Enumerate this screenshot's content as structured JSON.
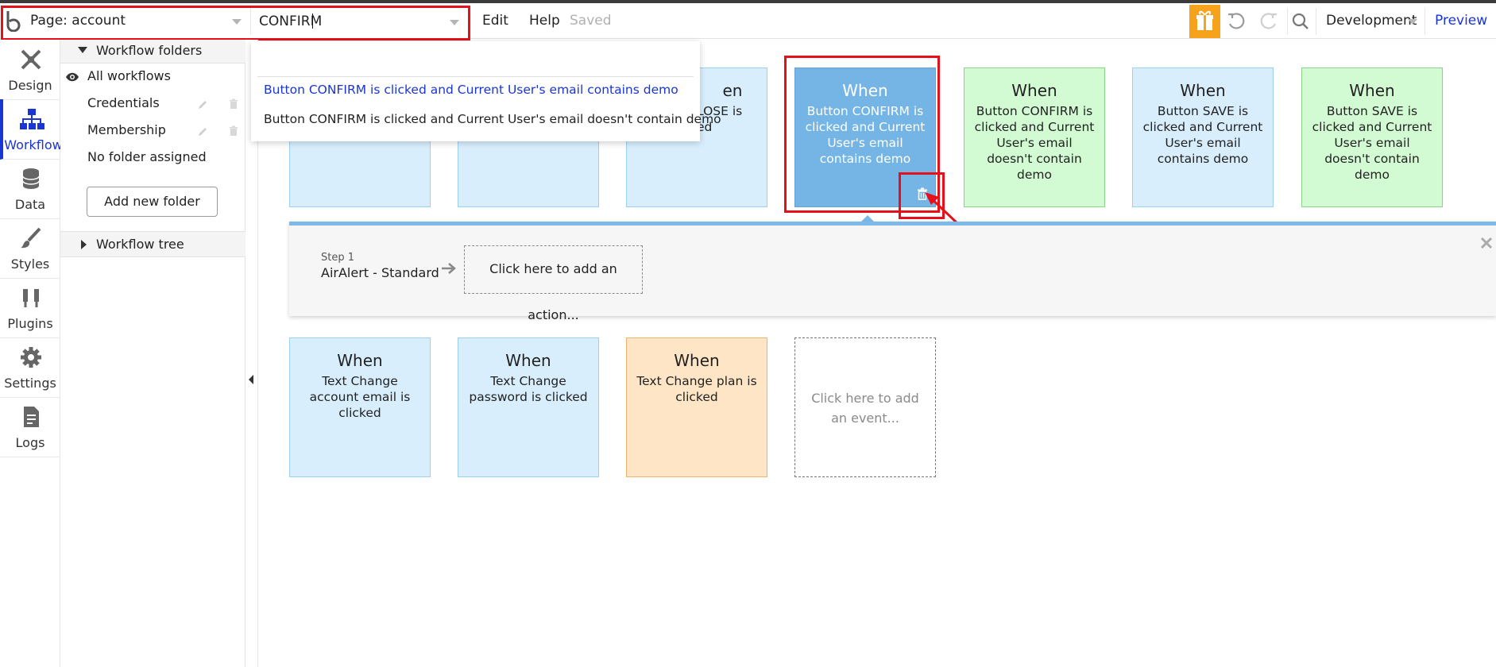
{
  "topbar": {
    "logo_icon": "bubble-logo-icon",
    "page_label": "Page: account",
    "search_value": "CONFIRM",
    "menu": {
      "edit": "Edit",
      "help": "Help",
      "status": "Saved"
    },
    "right": {
      "environment": "Development",
      "preview": "Preview"
    },
    "icons": [
      "gift-icon",
      "undo-icon",
      "redo-icon",
      "search-icon"
    ]
  },
  "rail": {
    "items": [
      {
        "label": "Design",
        "icon": "design-icon"
      },
      {
        "label": "Workflow",
        "icon": "workflow-icon"
      },
      {
        "label": "Data",
        "icon": "data-icon"
      },
      {
        "label": "Styles",
        "icon": "brush-icon"
      },
      {
        "label": "Plugins",
        "icon": "plugin-icon"
      },
      {
        "label": "Settings",
        "icon": "gear-icon"
      },
      {
        "label": "Logs",
        "icon": "logs-icon"
      }
    ],
    "active": "Workflow"
  },
  "panel": {
    "folders_header": "Workflow folders",
    "all_workflows": "All workflows",
    "folders": [
      "Credentials",
      "Membership"
    ],
    "no_folder": "No folder assigned",
    "add_folder_button": "Add new folder",
    "tree_header": "Workflow tree"
  },
  "dropdown": {
    "items": [
      "Button CONFIRM is clicked and Current User's email contains demo",
      "Button CONFIRM is clicked and Current User's email doesn't contain demo"
    ],
    "highlight_color": "#1a35d6"
  },
  "events_row1": [
    {
      "when": "",
      "desc": "",
      "color": "blue"
    },
    {
      "when": "",
      "desc": "",
      "color": "blue"
    },
    {
      "when": "en",
      "desc": "LOSE is\ned",
      "color": "blue"
    },
    {
      "when": "When",
      "desc": "Button CONFIRM is clicked and Current User's email contains demo",
      "color": "selected"
    },
    {
      "when": "When",
      "desc": "Button CONFIRM is clicked and Current User's email doesn't contain demo",
      "color": "green"
    },
    {
      "when": "When",
      "desc": "Button SAVE is clicked and Current User's email contains demo",
      "color": "blue"
    },
    {
      "when": "When",
      "desc": "Button SAVE is clicked and Current User's email doesn't contain demo",
      "color": "green"
    }
  ],
  "action_strip": {
    "step_label": "Step 1",
    "step_name": "AirAlert - Standard",
    "add_action": "Click here to add an action...",
    "close_icon": "close-icon"
  },
  "events_row2": [
    {
      "when": "When",
      "desc": "Text Change account email is clicked",
      "color": "blue"
    },
    {
      "when": "When",
      "desc": "Text Change password is clicked",
      "color": "blue"
    },
    {
      "when": "When",
      "desc": "Text Change plan is clicked",
      "color": "orange"
    },
    {
      "when": "",
      "desc": "Click here to add an event...",
      "color": "empty"
    }
  ],
  "colors": {
    "accent": "#1a35d6",
    "gift": "#f7a21b",
    "annotation_red": "#e5101a",
    "selected_card": "#74b5e5"
  }
}
